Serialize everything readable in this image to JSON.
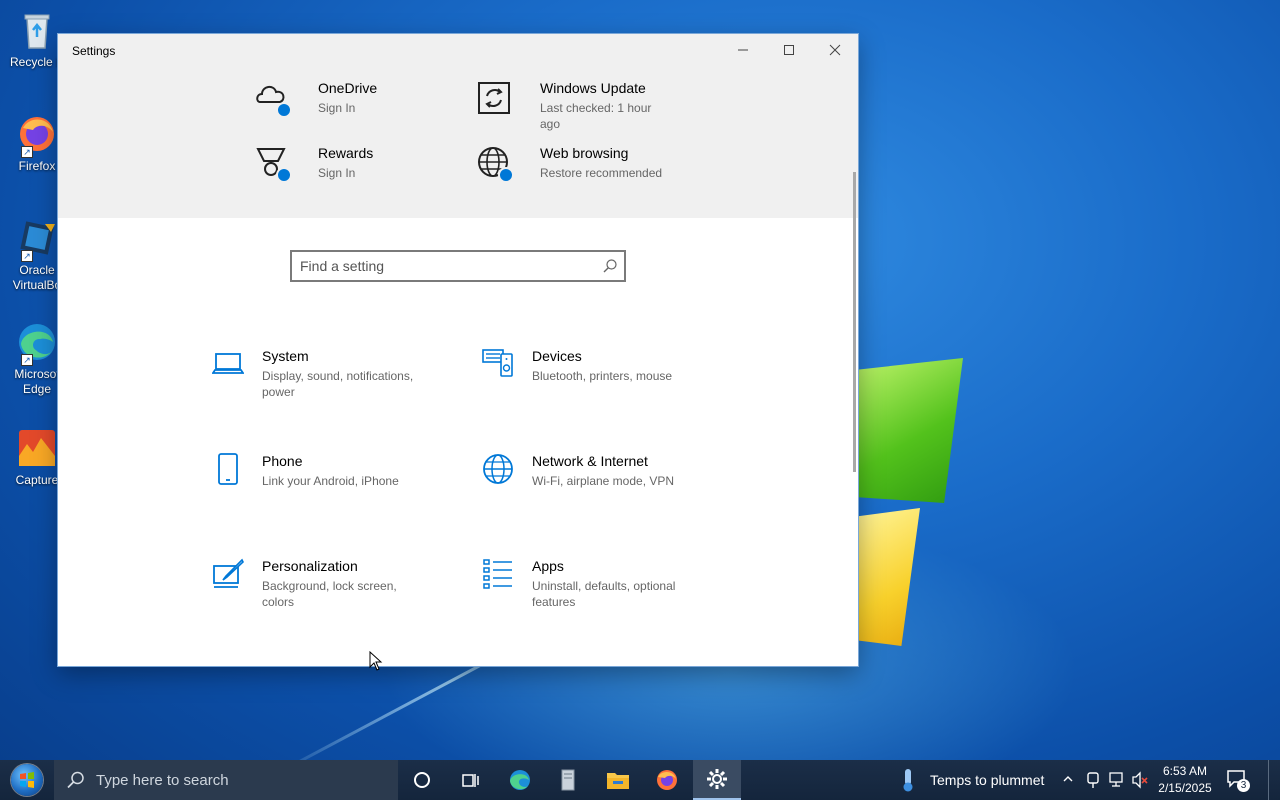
{
  "desktop": {
    "icons": [
      {
        "label": "Recycle B"
      },
      {
        "label": "Firefox"
      },
      {
        "label": "Oracle VirtualBo"
      },
      {
        "label": "Microsof Edge"
      },
      {
        "label": "Capture"
      }
    ]
  },
  "window": {
    "title": "Settings",
    "controls": {
      "minimize": "—",
      "maximize": "☐",
      "close": "✕"
    },
    "top_tiles": [
      {
        "title": "OneDrive",
        "subtitle": "Sign In",
        "icon": "cloud-icon"
      },
      {
        "title": "Windows Update",
        "subtitle": "Last checked: 1 hour ago",
        "icon": "update-icon"
      },
      {
        "title": "Rewards",
        "subtitle": "Sign In",
        "icon": "trophy-icon"
      },
      {
        "title": "Web browsing",
        "subtitle": "Restore recommended",
        "icon": "globe-icon"
      }
    ],
    "search": {
      "placeholder": "Find a setting"
    },
    "categories": [
      {
        "title": "System",
        "subtitle": "Display, sound, notifications, power",
        "icon": "laptop-icon"
      },
      {
        "title": "Devices",
        "subtitle": "Bluetooth, printers, mouse",
        "icon": "devices-icon"
      },
      {
        "title": "Phone",
        "subtitle": "Link your Android, iPhone",
        "icon": "phone-icon"
      },
      {
        "title": "Network & Internet",
        "subtitle": "Wi-Fi, airplane mode, VPN",
        "icon": "globe-icon"
      },
      {
        "title": "Personalization",
        "subtitle": "Background, lock screen, colors",
        "icon": "paint-icon"
      },
      {
        "title": "Apps",
        "subtitle": "Uninstall, defaults, optional features",
        "icon": "apps-list-icon"
      }
    ]
  },
  "taskbar": {
    "search_label": "Type here to search",
    "weather_text": "Temps to plummet",
    "time": "6:53 AM",
    "date": "2/15/2025",
    "notification_count": "3"
  },
  "colors": {
    "accent": "#0078d7",
    "taskbar": "#14253c"
  }
}
